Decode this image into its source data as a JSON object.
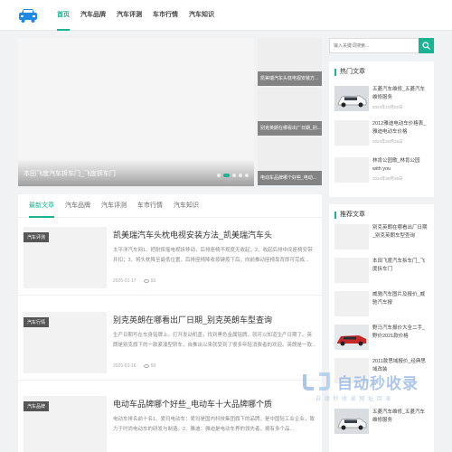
{
  "header": {
    "nav": [
      "首页",
      "汽车品牌",
      "汽车评测",
      "车市行情",
      "汽车知识"
    ]
  },
  "slider": {
    "title": "本田飞度汽车拆车门_飞度拆车门"
  },
  "thumbs": [
    "凯美瑞汽车头枕电视安装方...",
    "别克英朗在哪看出厂日期_别...",
    "电动车品牌哪个好些_电动..."
  ],
  "tabs": [
    "最新文章",
    "汽车品牌",
    "汽车评测",
    "车市行情",
    "汽车知识"
  ],
  "posts": [
    {
      "badge": "汽车评测",
      "title": "凯美瑞汽车头枕电视安装方法_凯美瑞汽车头",
      "excerpt": "太平洋汽车网1、把耐摔摇电视拆移动，后排座椅不规度无收起；2、收起后排中间座椅安带并扣；3、将头枕降至最低位置，后排座椅降收按键按下后，向前推动座椅靠背即可完成...",
      "date": "2025-01-17",
      "views": "93"
    },
    {
      "badge": "汽车行情",
      "title": "别克英朗在哪看出厂日期_别克英朗车型查询",
      "excerpt": "生产日期写在车身铭牌上。打开发动机盖，找到黑色金属铭牌，就可以知道生产日期了。英朗是别克旗下的一款紧凑型轿车，自推出以来就受到了很多年轻消费者的欢迎。英朗是一款...",
      "date": "2025-01-16",
      "views": "58"
    },
    {
      "badge": "汽车品牌",
      "title": "电动车品牌哪个好些_电动车十大品牌哪个质",
      "excerpt": "电动车排名前十名1、爱玛电动车：爱玛是国内科技集团旗下的品牌，是中国轻工业企业，致力于时尚电动车的研发与制造。2、雅迪：雅迪是电动车界的领先者，拥有多个品...",
      "date": "",
      "views": ""
    }
  ],
  "search": {
    "placeholder": "输入关键词搜索..."
  },
  "hot": {
    "title": "热门文章",
    "items": [
      {
        "title": "五菱汽车维修_五菱汽车维修服务",
        "date": "2024年10月02日"
      },
      {
        "title": "2012雅迪电动车价格表_雅迪电动车价格",
        "date": "2024年09月25日"
      },
      {
        "title": "林肯公园歌_林肯公园with you",
        "date": "2024年09月26日"
      }
    ]
  },
  "recommend": {
    "title": "推荐文章",
    "items": [
      {
        "title": "别克英朗在哪看出厂日期_别克英朗车型查询"
      },
      {
        "title": "本田飞度汽车拆车门_飞度拆车门"
      },
      {
        "title": "威驰汽车图片及报价_威驰汽车报"
      },
      {
        "title": "野马汽车报价大全二手_野价2021款价格"
      },
      {
        "title": "2011款思域报价_经典思域改装"
      },
      {
        "title": "五菱汽车维修_五菱汽车维修服务"
      }
    ]
  },
  "watermark": {
    "text": "自动秒收录",
    "sub": "自 动 秒 收 录 网 址 目 录"
  },
  "colors": {
    "accent": "#1ab394"
  }
}
